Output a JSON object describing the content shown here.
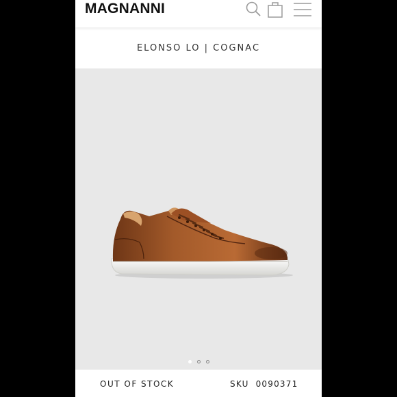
{
  "brand": {
    "logo_text": "MAGNANNI"
  },
  "header": {
    "icons": [
      "search-icon",
      "shopping-bag-icon",
      "hamburger-menu-icon"
    ],
    "icon_color": "#9a9a9a"
  },
  "product": {
    "title": "ELONSO LO | COGNAC",
    "image_background": "#e8e8e8",
    "carousel": {
      "total": 3,
      "active": 1
    }
  },
  "footer": {
    "stock_status": "OUT OF STOCK",
    "sku_label": "SKU",
    "sku_value": "0090371"
  },
  "colors": {
    "page_bg": "#000000",
    "panel_bg": "#ffffff",
    "shoe_leather": "#8a4a22"
  }
}
